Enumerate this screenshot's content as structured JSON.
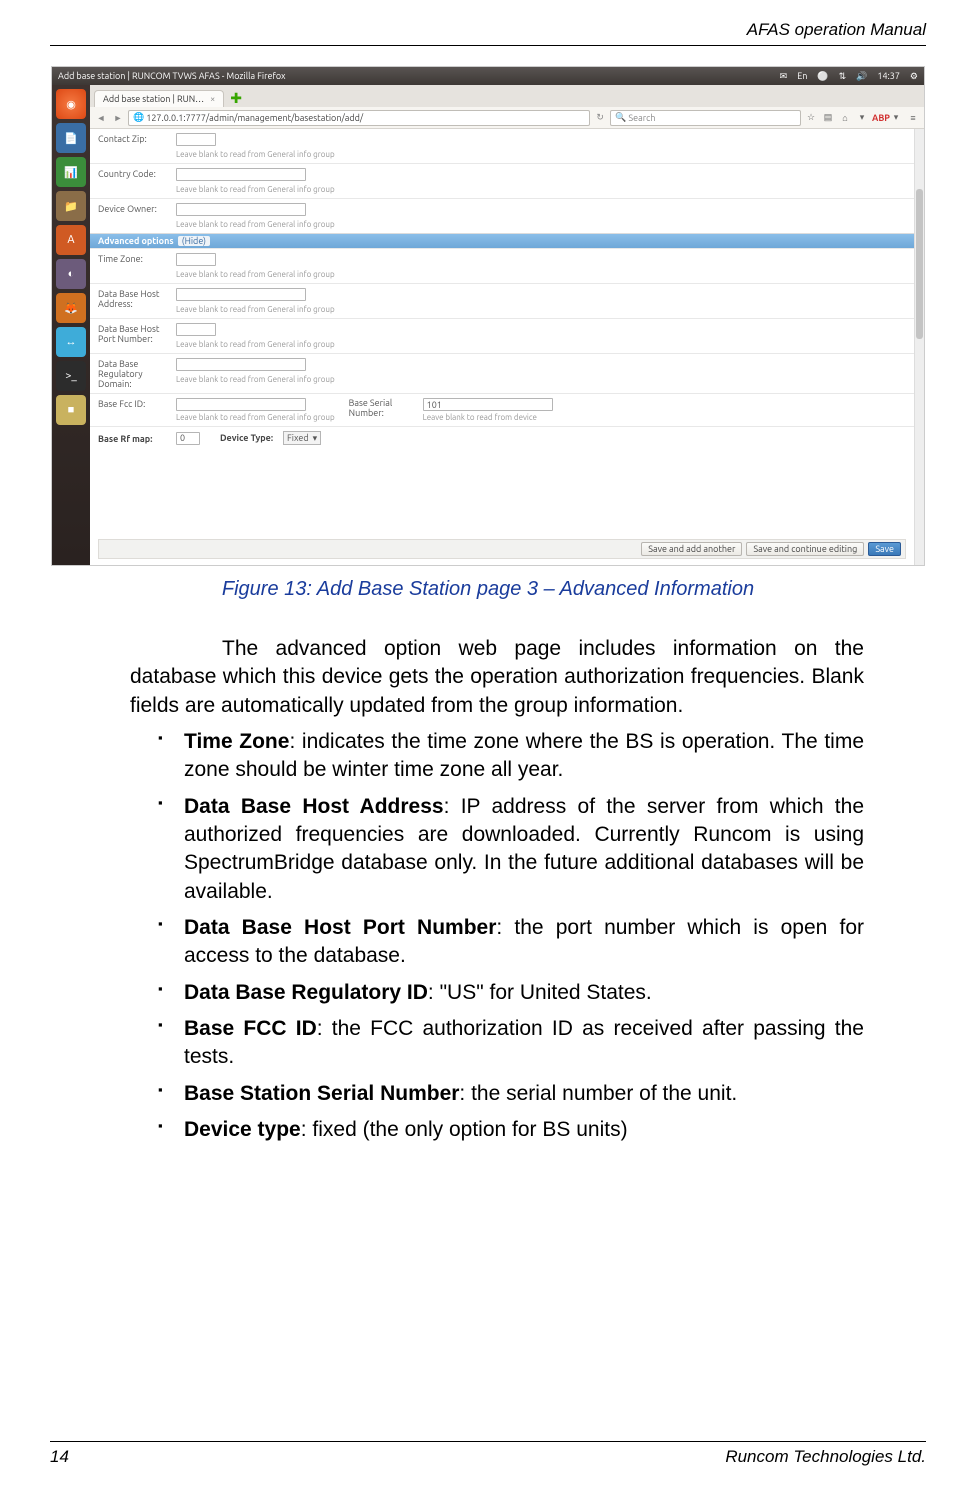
{
  "header": {
    "title": "AFAS operation Manual"
  },
  "footer": {
    "page": "14",
    "company": "Runcom Technologies Ltd."
  },
  "screenshot": {
    "window_title": "Add base station | RUNCOM TVWS AFAS - Mozilla Firefox",
    "topbar_icons": {
      "lang": "En",
      "time": "14:37"
    },
    "tab_label": "Add base station | RUN…",
    "newtab_glyph": "✚",
    "tab_close": "×",
    "nav": {
      "back": "◄",
      "fwd": "►",
      "reload": "↻"
    },
    "url": "127.0.0.1:7777/admin/management/basestation/add/",
    "search_placeholder": "Search",
    "toolbar_icons": {
      "star": "☆",
      "stack": "▤",
      "home": "⌂",
      "down": "▾",
      "abp": "ABP",
      "menu": "≡"
    },
    "fields_top": [
      {
        "label": "Contact Zip:",
        "hint": "Leave blank to read from General info group",
        "size": "short"
      },
      {
        "label": "Country Code:",
        "hint": "Leave blank to read from General info group",
        "size": "med"
      },
      {
        "label": "Device Owner:",
        "hint": "Leave blank to read from General info group",
        "size": "med"
      }
    ],
    "adv_header": "Advanced options",
    "adv_hide": "(Hide)",
    "fields_adv": [
      {
        "label": "Time Zone:",
        "hint": "Leave blank to read from General info group",
        "size": "short"
      },
      {
        "label": "Data Base Host Address:",
        "hint": "Leave blank to read from General info group",
        "size": "med"
      },
      {
        "label": "Data Base Host Port Number:",
        "hint": "Leave blank to read from General info group",
        "size": "short"
      },
      {
        "label": "Data Base Regulatory Domain:",
        "hint": "Leave blank to read from General info group",
        "size": "med"
      }
    ],
    "fcc": {
      "label": "Base Fcc ID:",
      "hint": "Leave blank to read from General info group",
      "serial_label": "Base Serial Number:",
      "serial_value": "101",
      "serial_hint": "Leave blank to read from device"
    },
    "rf_row": {
      "rf_label": "Base Rf map:",
      "rf_value": "0",
      "dev_label": "Device Type:",
      "dev_value": "Fixed"
    },
    "buttons": {
      "add_another": "Save and add another",
      "continue": "Save and continue editing",
      "save": "Save"
    }
  },
  "caption": "Figure 13: Add Base Station page 3 – Advanced Information",
  "intro": "The advanced option web page includes information on the database which this device gets the operation authorization frequencies. Blank fields are automatically updated from the group information.",
  "items": [
    {
      "term": "Time Zone",
      "desc": ": indicates the time zone where the BS is operation. The time zone should be winter time zone all year."
    },
    {
      "term": "Data Base Host Address",
      "desc": ": IP address of the server from which the authorized frequencies are downloaded. Currently Runcom is using SpectrumBridge database only. In the future additional databases will be available."
    },
    {
      "term": "Data Base Host Port Number",
      "desc": ": the port number which is open for access to the database."
    },
    {
      "term": "Data Base Regulatory ID",
      "desc": ": \"US\" for United States."
    },
    {
      "term": "Base FCC ID",
      "desc": ": the FCC authorization ID as received after passing the tests."
    },
    {
      "term": "Base Station Serial Number",
      "desc": ": the serial number of the unit."
    },
    {
      "term": "Device type",
      "desc": ": fixed (the only option for BS units)"
    }
  ]
}
